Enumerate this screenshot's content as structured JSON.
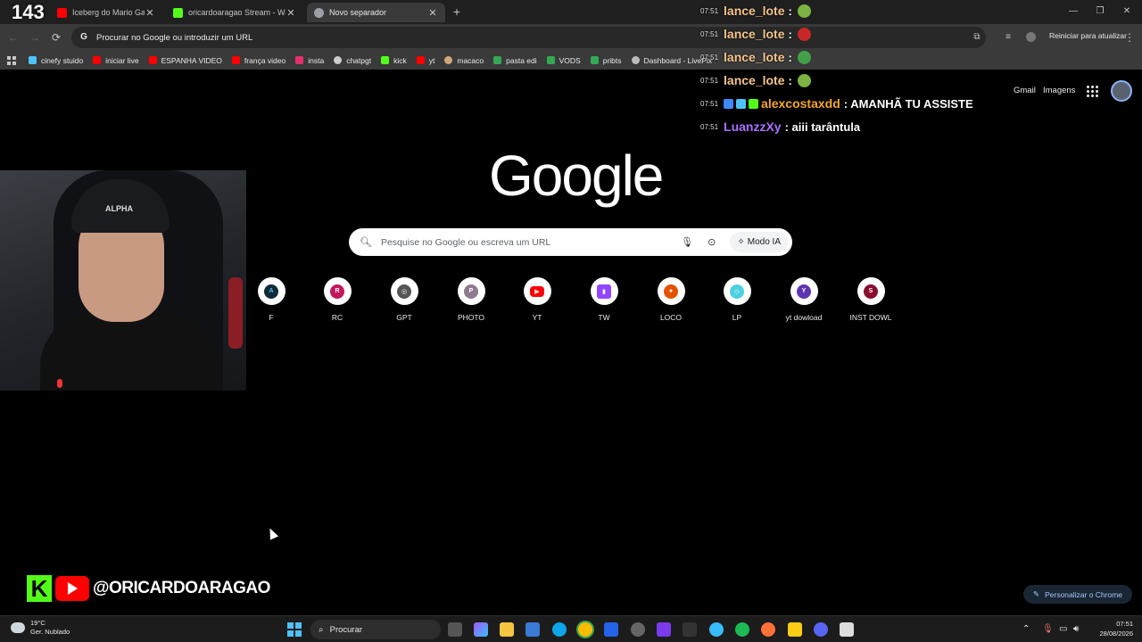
{
  "stream_counter": "143",
  "tabs": [
    {
      "title": "Iceberg do Mario Games de",
      "icon": "youtube-favicon",
      "color": "#ff0000",
      "active": false
    },
    {
      "title": "oricardoaragao Stream - Watch",
      "icon": "kick-favicon",
      "color": "#53fc18",
      "active": false
    },
    {
      "title": "Novo separador",
      "icon": "chrome-favicon",
      "color": "#9aa0a6",
      "active": true
    }
  ],
  "window_controls": {
    "minimize": "—",
    "maximize": "❐",
    "close": "✕"
  },
  "toolbar": {
    "back": "←",
    "forward": "→",
    "reload": "⟳",
    "omnibox_placeholder": "Procurar no Google ou introduzir um URL",
    "restart_label": "Reiniciar para atualizar",
    "menu": "⋮"
  },
  "bookmarks": [
    {
      "label": "cinefy stuido",
      "color": "#4fc3f7"
    },
    {
      "label": "iniciar live",
      "color": "#ff0000"
    },
    {
      "label": "ESPANHA VIDEO",
      "color": "#ff0000"
    },
    {
      "label": "frança video",
      "color": "#ff0000"
    },
    {
      "label": "insta",
      "color": "#e1306c"
    },
    {
      "label": "chatpgt",
      "color": "#cccccc"
    },
    {
      "label": "kick",
      "color": "#53fc18"
    },
    {
      "label": "yt",
      "color": "#ff0000"
    },
    {
      "label": "macaco",
      "color": "#d2a679"
    },
    {
      "label": "pasta edi",
      "color": "#34a853"
    },
    {
      "label": "VODS",
      "color": "#34a853"
    },
    {
      "label": "pribts",
      "color": "#34a853"
    },
    {
      "label": "Dashboard - LivePix",
      "color": "#bbbbbb"
    }
  ],
  "google": {
    "gmail": "Gmail",
    "images": "Imagens",
    "logo": "Google",
    "search_placeholder": "Pesquise no Google ou escreva um URL",
    "ai_mode": "Modo IA",
    "customize": "Personalizar o Chrome"
  },
  "shortcuts": [
    {
      "label": "F",
      "letter": "A",
      "color": "#0f2b3a"
    },
    {
      "label": "RC",
      "letter": "R",
      "color": "#c2185b"
    },
    {
      "label": "GPT",
      "letter": "◎",
      "color": "#555555"
    },
    {
      "label": "PHOTO",
      "letter": "P",
      "color": "#8d7a8f"
    },
    {
      "label": "YT",
      "letter": "▶",
      "color": "#ff0000"
    },
    {
      "label": "TW",
      "letter": "▮",
      "color": "#9146ff"
    },
    {
      "label": "LOCO",
      "letter": "●",
      "color": "#e65100"
    },
    {
      "label": "LP",
      "letter": "◇",
      "color": "#4dd0e1"
    },
    {
      "label": "yt dowload",
      "letter": "Y",
      "color": "#5e35b1"
    },
    {
      "label": "INST DOWL",
      "letter": "S",
      "color": "#880e2f"
    }
  ],
  "chat": [
    {
      "time": "07:51",
      "user": "lance_lote",
      "user_color": "#f4c48b",
      "msg": ":",
      "emote_color": "#7cb342"
    },
    {
      "time": "07:51",
      "user": "lance_lote",
      "user_color": "#f4c48b",
      "msg": ":",
      "emote_color": "#c62828"
    },
    {
      "time": "07:51",
      "user": "lance_lote",
      "user_color": "#f4c48b",
      "msg": ":",
      "emote_color": "#43a047"
    },
    {
      "time": "07:51",
      "user": "lance_lote",
      "user_color": "#f4c48b",
      "msg": ":",
      "emote_color": "#7cb342"
    },
    {
      "time": "07:51",
      "user": "alexcostaxdd",
      "user_color": "#f5a623",
      "msg": ": AMANHÃ TU ASSISTE",
      "emote_color": ""
    },
    {
      "time": "07:51",
      "user": "LuanzzXy",
      "user_color": "#a970ff",
      "msg": ": aiii tarântula",
      "emote_color": ""
    }
  ],
  "webcam": {
    "cap_text": "ALPHA"
  },
  "overlay": {
    "kick_letter": "K",
    "handle": "@ORICARDOARAGAO"
  },
  "taskbar": {
    "temperature": "19°C",
    "weather": "Ger. Nublado",
    "search": "Procurar",
    "time": "07:51",
    "date": "28/08/2026"
  }
}
